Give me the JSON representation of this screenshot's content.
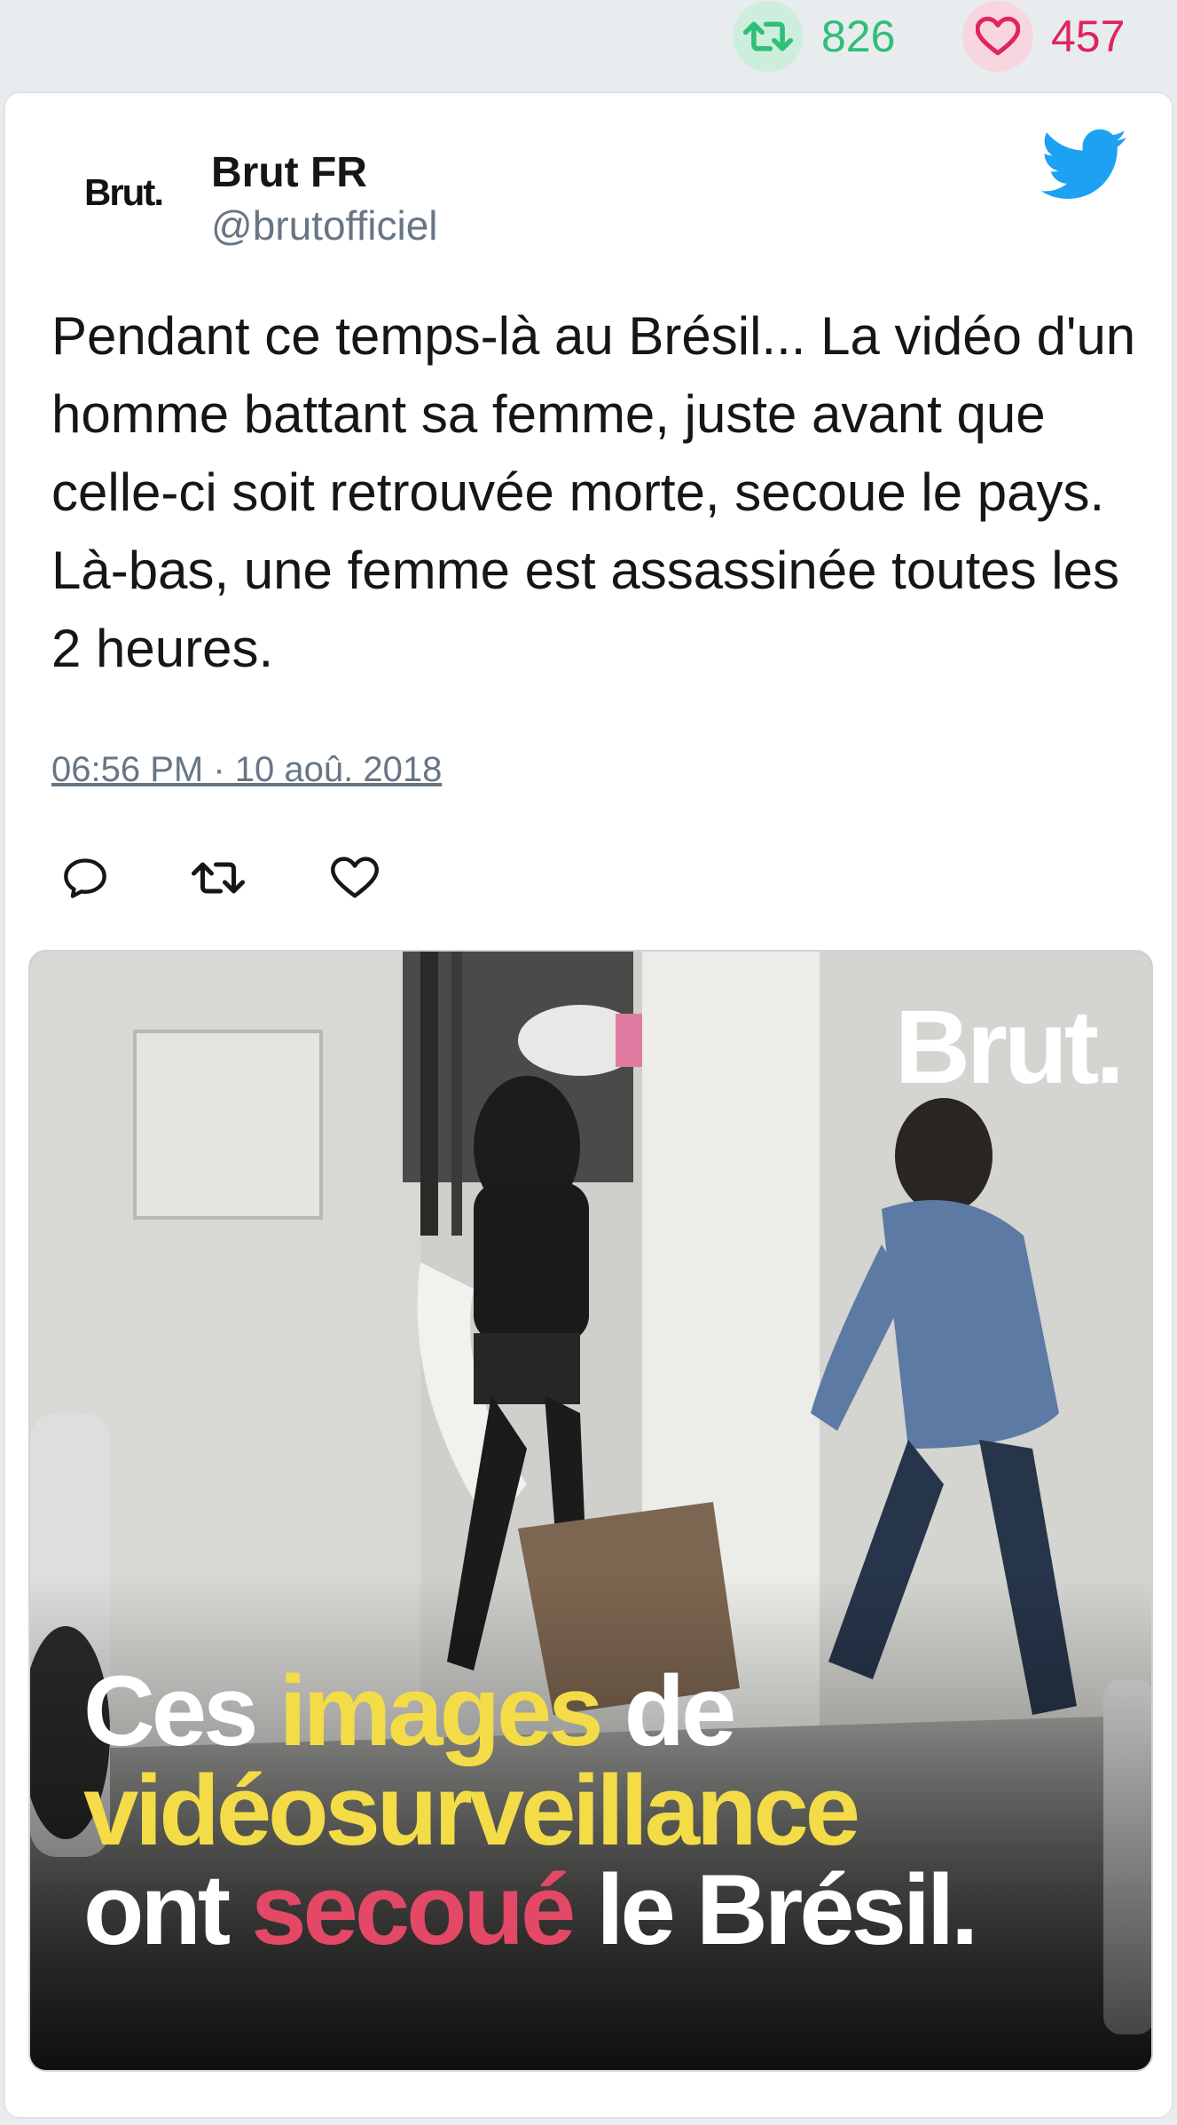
{
  "stats": {
    "retweets": "826",
    "likes": "457"
  },
  "tweet": {
    "avatar_text": "Brut.",
    "name": "Brut FR",
    "handle": "@brutofficiel",
    "text": "Pendant ce temps-là au Brésil... La vidéo d'un homme battant sa femme, juste avant que celle-ci soit retrouvée morte, secoue le pays. Là-bas, une femme est assassinée toutes les 2 heures.",
    "timestamp": "06:56 PM · 10 aoû. 2018"
  },
  "media": {
    "watermark": "Brut.",
    "caption": {
      "line1_a": "Ces ",
      "line1_b": "images",
      "line1_c": " de",
      "line2": "vidéosurveillance",
      "line3_a": "ont ",
      "line3_b": "secoué",
      "line3_c": " le Brésil."
    }
  },
  "icons": {
    "retweet_stat": "retweet-icon",
    "like_stat": "heart-icon",
    "brand": "twitter-bird-icon",
    "reply": "reply-icon",
    "retweet": "retweet-icon",
    "like": "heart-icon"
  },
  "colors": {
    "retweet": "#2fbf78",
    "like": "#e0245e",
    "twitter_blue": "#1da1f2",
    "caption_yellow": "#f3dc47",
    "caption_red": "#e44867"
  }
}
